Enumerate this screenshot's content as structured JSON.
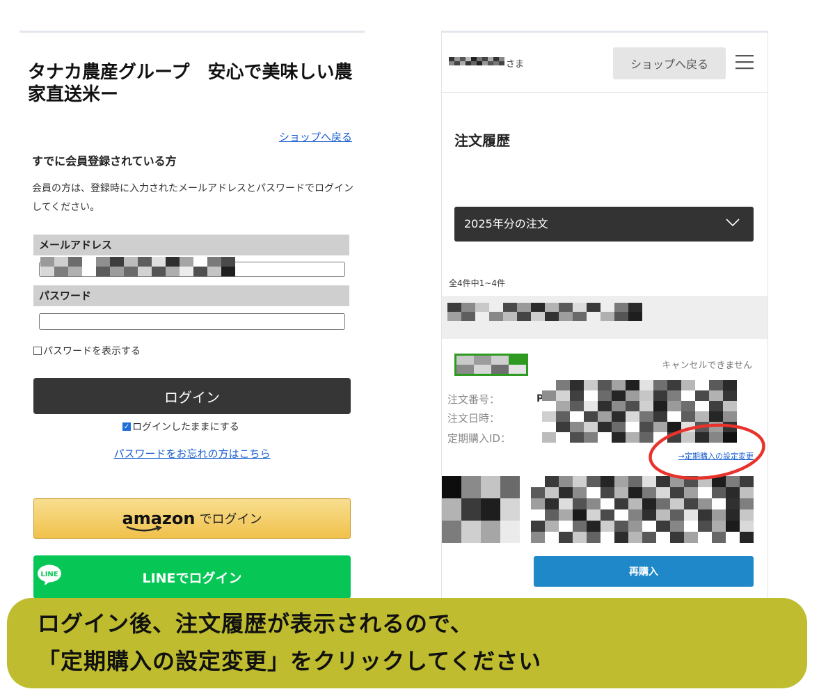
{
  "login": {
    "shop_title": "タナカ農産グループ　安心で美味しい農家直送米ー",
    "back_to_shop": "ショップへ戻る",
    "member_heading": "すでに会員登録されている方",
    "member_desc": "会員の方は、登録時に入力されたメールアドレスとパスワードでログインしてください。",
    "email_label": "メールアドレス",
    "password_label": "パスワード",
    "show_password": "パスワードを表示する",
    "login_button": "ログイン",
    "keep_logged_in": "ログインしたままにする",
    "forgot_password": "パスワードをお忘れの方はこちら",
    "amazon_word": "amazon",
    "amazon_suffix": "でログイン",
    "line_icon_text": "LINE",
    "line_button": "LINEでログイン"
  },
  "orders": {
    "user_suffix": "さま",
    "back_to_shop": "ショップへ戻る",
    "page_title": "注文履歴",
    "year_select": "2025年分の注文",
    "count_text": "全4件中1~4件",
    "cancel_note": "キャンセルできません",
    "order_no_label": "注文番号：",
    "order_no_prefix": "P",
    "order_date_label": "注文日時：",
    "subscription_id_label": "定期購入ID：",
    "subscription_link": "→定期購入の設定変更",
    "rebuy_button": "再購入"
  },
  "instruction": {
    "line1": "ログイン後、注文履歴が表示されるので、",
    "line2": "「定期購入の設定変更」をクリックしてください"
  },
  "colors": {
    "highlight": "#e8332c",
    "banner": "#bfbd2f",
    "line_green": "#06c755",
    "status_green": "#2f9a22",
    "link_blue": "#1a5fd0",
    "rebuy_blue": "#1e88c8"
  }
}
